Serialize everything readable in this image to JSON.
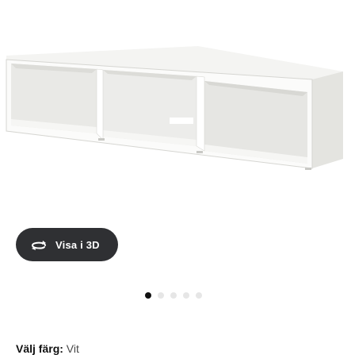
{
  "product": {
    "image_alt": "White TV bench with three open compartments"
  },
  "view_3d_button": {
    "label": "Visa i 3D",
    "icon": "rotate-3d-icon"
  },
  "carousel": {
    "count": 5,
    "active_index": 0
  },
  "color_selection": {
    "label": "Välj färg:",
    "value": "Vit"
  },
  "colors": {
    "button_bg": "#2f3033",
    "dot_active": "#111111",
    "dot_inactive": "#e6e6e6"
  }
}
